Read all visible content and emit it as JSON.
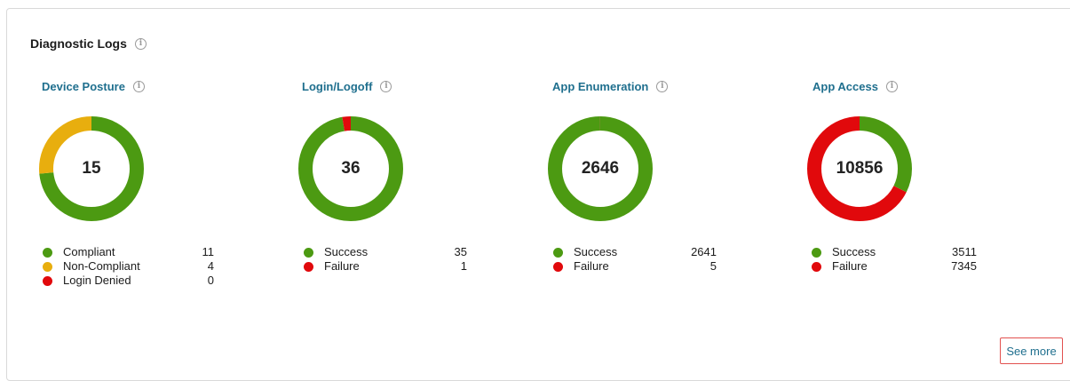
{
  "panel": {
    "title": "Diagnostic Logs"
  },
  "icons": {
    "info": "info-icon"
  },
  "colors": {
    "green": "#4c9a12",
    "yellow": "#e8ae0e",
    "red": "#e1090c",
    "link": "#1f6f8e"
  },
  "cards": [
    {
      "title": "Device Posture",
      "total": "15",
      "legend": [
        {
          "label": "Compliant",
          "value": "11",
          "color": "#4c9a12"
        },
        {
          "label": "Non-Compliant",
          "value": "4",
          "color": "#e8ae0e"
        },
        {
          "label": "Login Denied",
          "value": "0",
          "color": "#e1090c"
        }
      ]
    },
    {
      "title": "Login/Logoff",
      "total": "36",
      "legend": [
        {
          "label": "Success",
          "value": "35",
          "color": "#4c9a12"
        },
        {
          "label": "Failure",
          "value": "1",
          "color": "#e1090c"
        }
      ]
    },
    {
      "title": "App Enumeration",
      "total": "2646",
      "legend": [
        {
          "label": "Success",
          "value": "2641",
          "color": "#4c9a12"
        },
        {
          "label": "Failure",
          "value": "5",
          "color": "#e1090c"
        }
      ]
    },
    {
      "title": "App Access",
      "total": "10856",
      "legend": [
        {
          "label": "Success",
          "value": "3511",
          "color": "#4c9a12"
        },
        {
          "label": "Failure",
          "value": "7345",
          "color": "#e1090c"
        }
      ]
    }
  ],
  "footer": {
    "see_more_label": "See more"
  }
}
